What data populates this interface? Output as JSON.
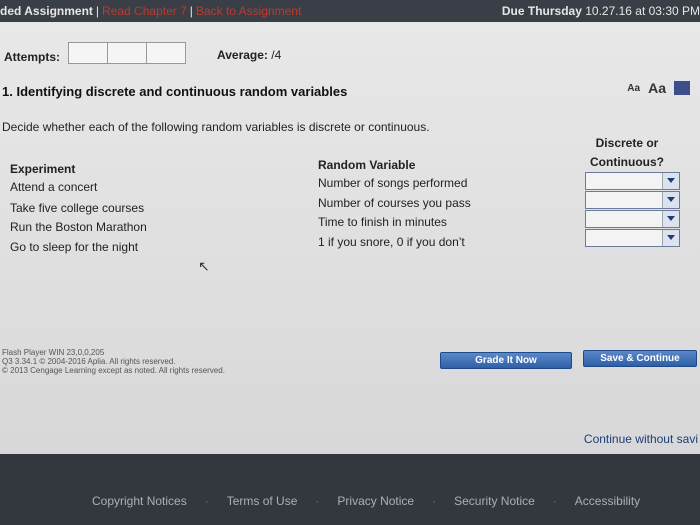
{
  "topbar": {
    "title": "ded Assignment",
    "links": [
      "Read Chapter 7",
      "Back to Assignment"
    ],
    "due_label": "Due Thursday",
    "due_datetime": "10.27.16 at 03:30 PM"
  },
  "attempts": {
    "label": "Attempts:",
    "average_label": "Average:",
    "average_value": "/4"
  },
  "question": {
    "title": "1. Identifying discrete and continuous random variables",
    "font_small": "Aa",
    "font_large": "Aa",
    "prompt": "Decide whether each of the following random variables is discrete or continuous."
  },
  "table": {
    "experiment_header": "Experiment",
    "random_variable_header": "Random Variable",
    "classification_header_line1": "Discrete or",
    "classification_header_line2": "Continuous?",
    "rows": [
      {
        "experiment": "Attend a concert",
        "variable": "Number of songs performed"
      },
      {
        "experiment": "Take five college courses",
        "variable": "Number of courses you pass"
      },
      {
        "experiment": "Run the Boston Marathon",
        "variable": "Time to finish in minutes"
      },
      {
        "experiment": "Go to sleep for the night",
        "variable": "1 if you snore, 0 if you don’t"
      }
    ]
  },
  "footer_info": {
    "line1": "Flash Player WIN 23,0,0,205",
    "line2": "Q3 3.34.1 © 2004-2016 Aplia. All rights reserved.",
    "line3": "© 2013 Cengage Learning except as noted. All rights reserved."
  },
  "buttons": {
    "grade": "Grade It Now",
    "save": "Save & Continue"
  },
  "continue_link": "Continue without savi",
  "bottom_links": [
    "Copyright Notices",
    "Terms of Use",
    "Privacy Notice",
    "Security Notice",
    "Accessibility"
  ],
  "colors": {
    "topbar": "#3a3f47",
    "link_red": "#c0392b",
    "button_blue": "#2f5fa8",
    "footer": "#33383f"
  }
}
